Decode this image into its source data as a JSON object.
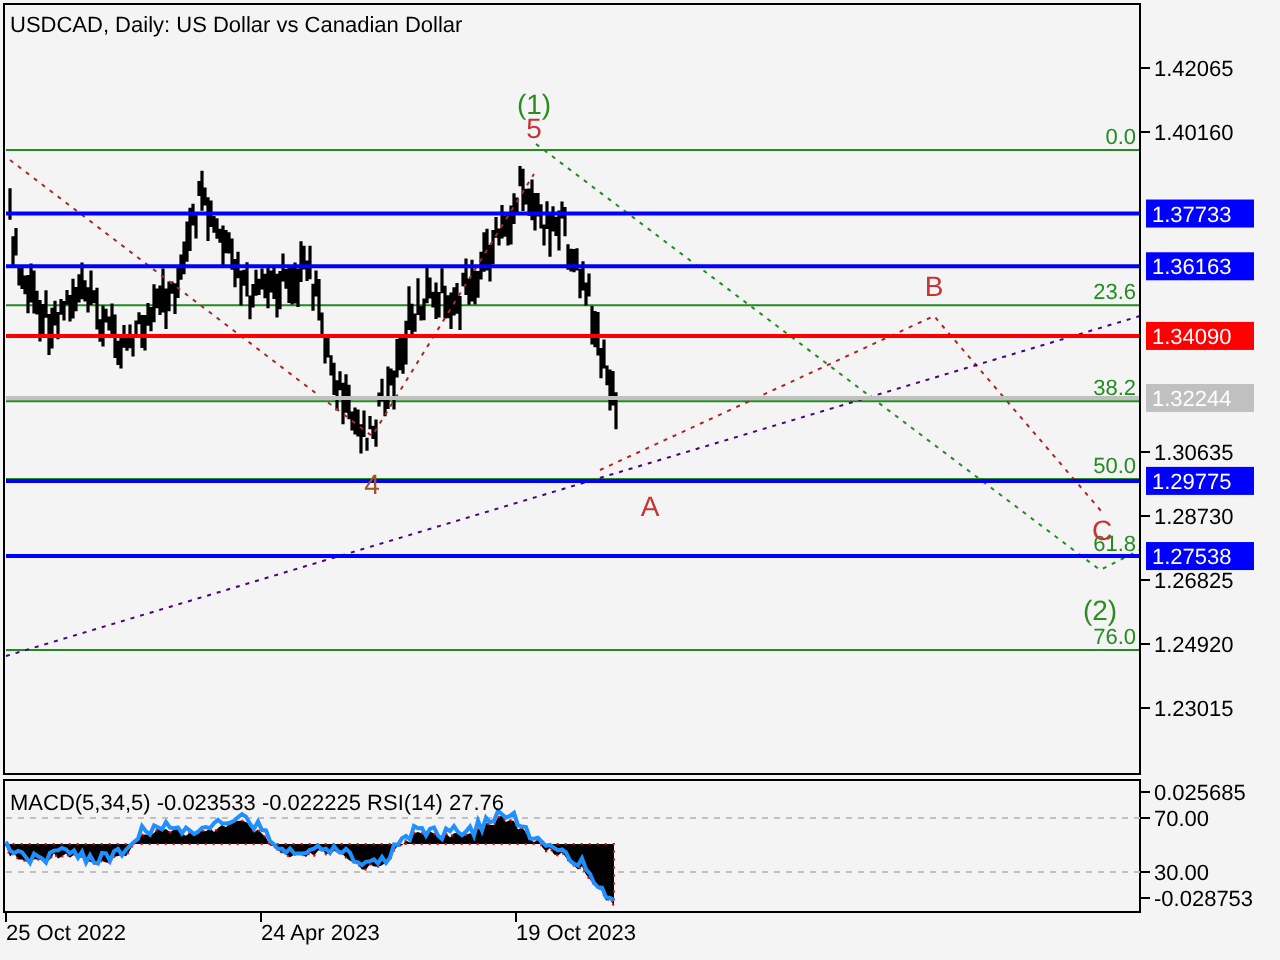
{
  "title": "USDCAD, Daily:  US Dollar vs Canadian Dollar",
  "price_axis": [
    {
      "label": "1.42065"
    },
    {
      "label": "1.40160"
    },
    {
      "label": "1.30635"
    },
    {
      "label": "1.28730"
    },
    {
      "label": "1.26825"
    },
    {
      "label": "1.24920"
    },
    {
      "label": "1.23015"
    }
  ],
  "levels": [
    {
      "label": "1.37733",
      "color": "#0000ff"
    },
    {
      "label": "1.36163",
      "color": "#0000ff"
    },
    {
      "label": "1.34090",
      "color": "#ff0000"
    },
    {
      "label": "1.32244",
      "color": "#c0c0c0"
    },
    {
      "label": "1.29775",
      "color": "#0000ff"
    },
    {
      "label": "1.27538",
      "color": "#0000ff"
    }
  ],
  "fibonacci": [
    {
      "label": "0.0"
    },
    {
      "label": "23.6"
    },
    {
      "label": "38.2"
    },
    {
      "label": "50.0"
    },
    {
      "label": "61.8"
    },
    {
      "label": "76.0"
    }
  ],
  "wave_labels": [
    {
      "label": "(1)",
      "color": "#2e8b22"
    },
    {
      "label": "5",
      "color": "#c83232"
    },
    {
      "label": "4",
      "color": "#a0522d"
    },
    {
      "label": "A",
      "color": "#c83232"
    },
    {
      "label": "B",
      "color": "#c83232"
    },
    {
      "label": "C",
      "color": "#c83232"
    },
    {
      "label": "(2)",
      "color": "#2e8b22"
    }
  ],
  "indicator": {
    "title": "MACD(5,34,5) -0.023533 -0.022225 RSI(14) 27.76",
    "axis": [
      {
        "label": "0.025685"
      },
      {
        "label": "70.00"
      },
      {
        "label": "30.00"
      },
      {
        "label": "-0.028753"
      }
    ]
  },
  "dates": [
    {
      "label": "25 Oct 2022"
    },
    {
      "label": "24 Apr 2023"
    },
    {
      "label": "19 Oct 2023"
    }
  ]
}
